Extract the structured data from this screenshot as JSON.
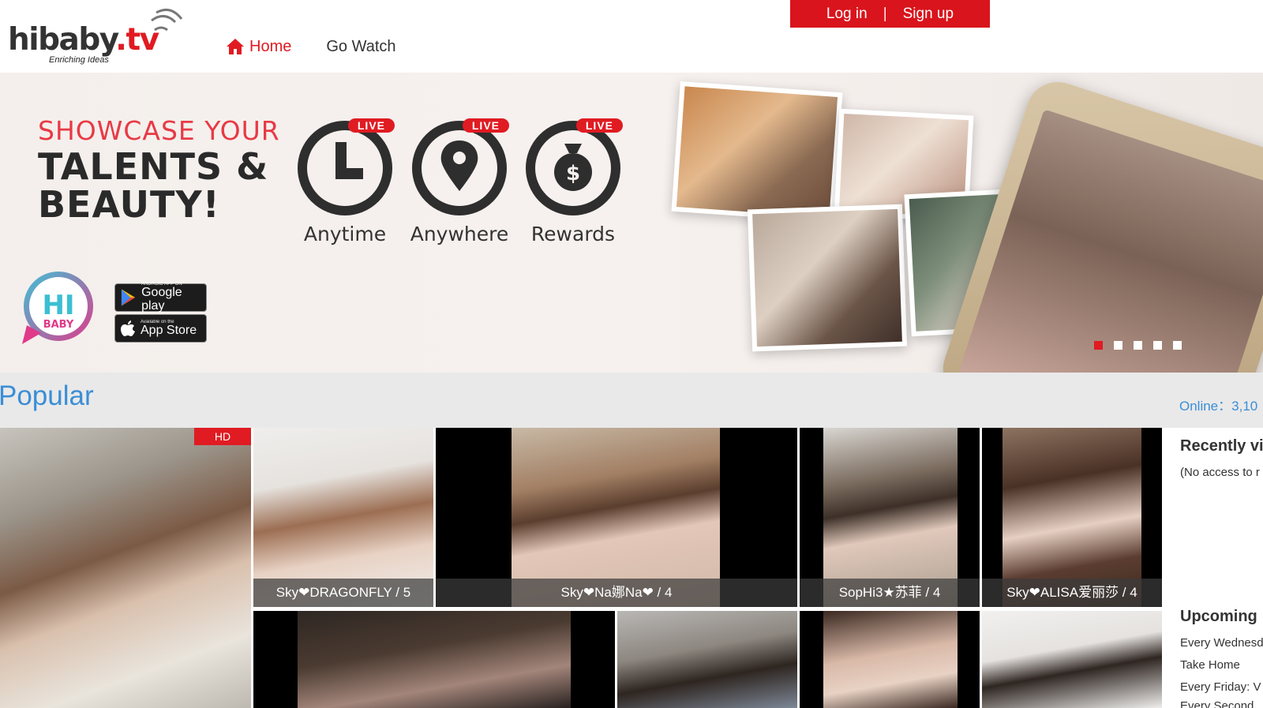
{
  "header": {
    "logo_text_main": "hibaby",
    "logo_text_tv": ".tv",
    "logo_tagline": "Enriching Ideas",
    "nav": [
      {
        "label": "Home",
        "icon": "home-icon",
        "active": true
      },
      {
        "label": "Go Watch",
        "active": false
      }
    ],
    "login_label": "Log in",
    "separator": "|",
    "signup_label": "Sign up"
  },
  "banner": {
    "line1": "SHOWCASE YOUR",
    "line2": "TALENTS &",
    "line3": "BEAUTY!",
    "features": [
      {
        "label": "Anytime",
        "icon": "clock-icon",
        "tag": "LIVE"
      },
      {
        "label": "Anywhere",
        "icon": "location-pin-icon",
        "tag": "LIVE"
      },
      {
        "label": "Rewards",
        "icon": "money-bag-icon",
        "tag": "LIVE"
      }
    ],
    "badge_hi": "HI",
    "badge_baby": "BABY",
    "google_play": {
      "small": "ANDROID APP ON",
      "big": "Google play"
    },
    "app_store": {
      "small": "Available on the",
      "big": "App Store"
    },
    "slides_total": 5,
    "slide_active": 1
  },
  "popular": {
    "title": "Popular",
    "online_label": "Online：3,10",
    "tiles": [
      {
        "caption": "",
        "hd": "HD"
      },
      {
        "caption": "Sky❤DRAGONFLY / 5"
      },
      {
        "caption": "Sky❤Na娜Na❤ / 4"
      },
      {
        "caption": "SopHi3★苏菲 / 4"
      },
      {
        "caption": "Sky❤ALISA爱丽莎 / 4"
      },
      {
        "caption": ""
      },
      {
        "caption": ""
      },
      {
        "caption": ""
      },
      {
        "caption": ""
      }
    ]
  },
  "sidebar": {
    "recent_title": "Recently vi",
    "recent_text": "(No access to r",
    "upcoming_title": "Upcoming",
    "upcoming": [
      "Every Wednesd",
      "Take Home",
      "Every Friday: V",
      "Every Second"
    ]
  },
  "colors": {
    "brand_red": "#e01b22",
    "link_blue": "#3b8ed6"
  }
}
